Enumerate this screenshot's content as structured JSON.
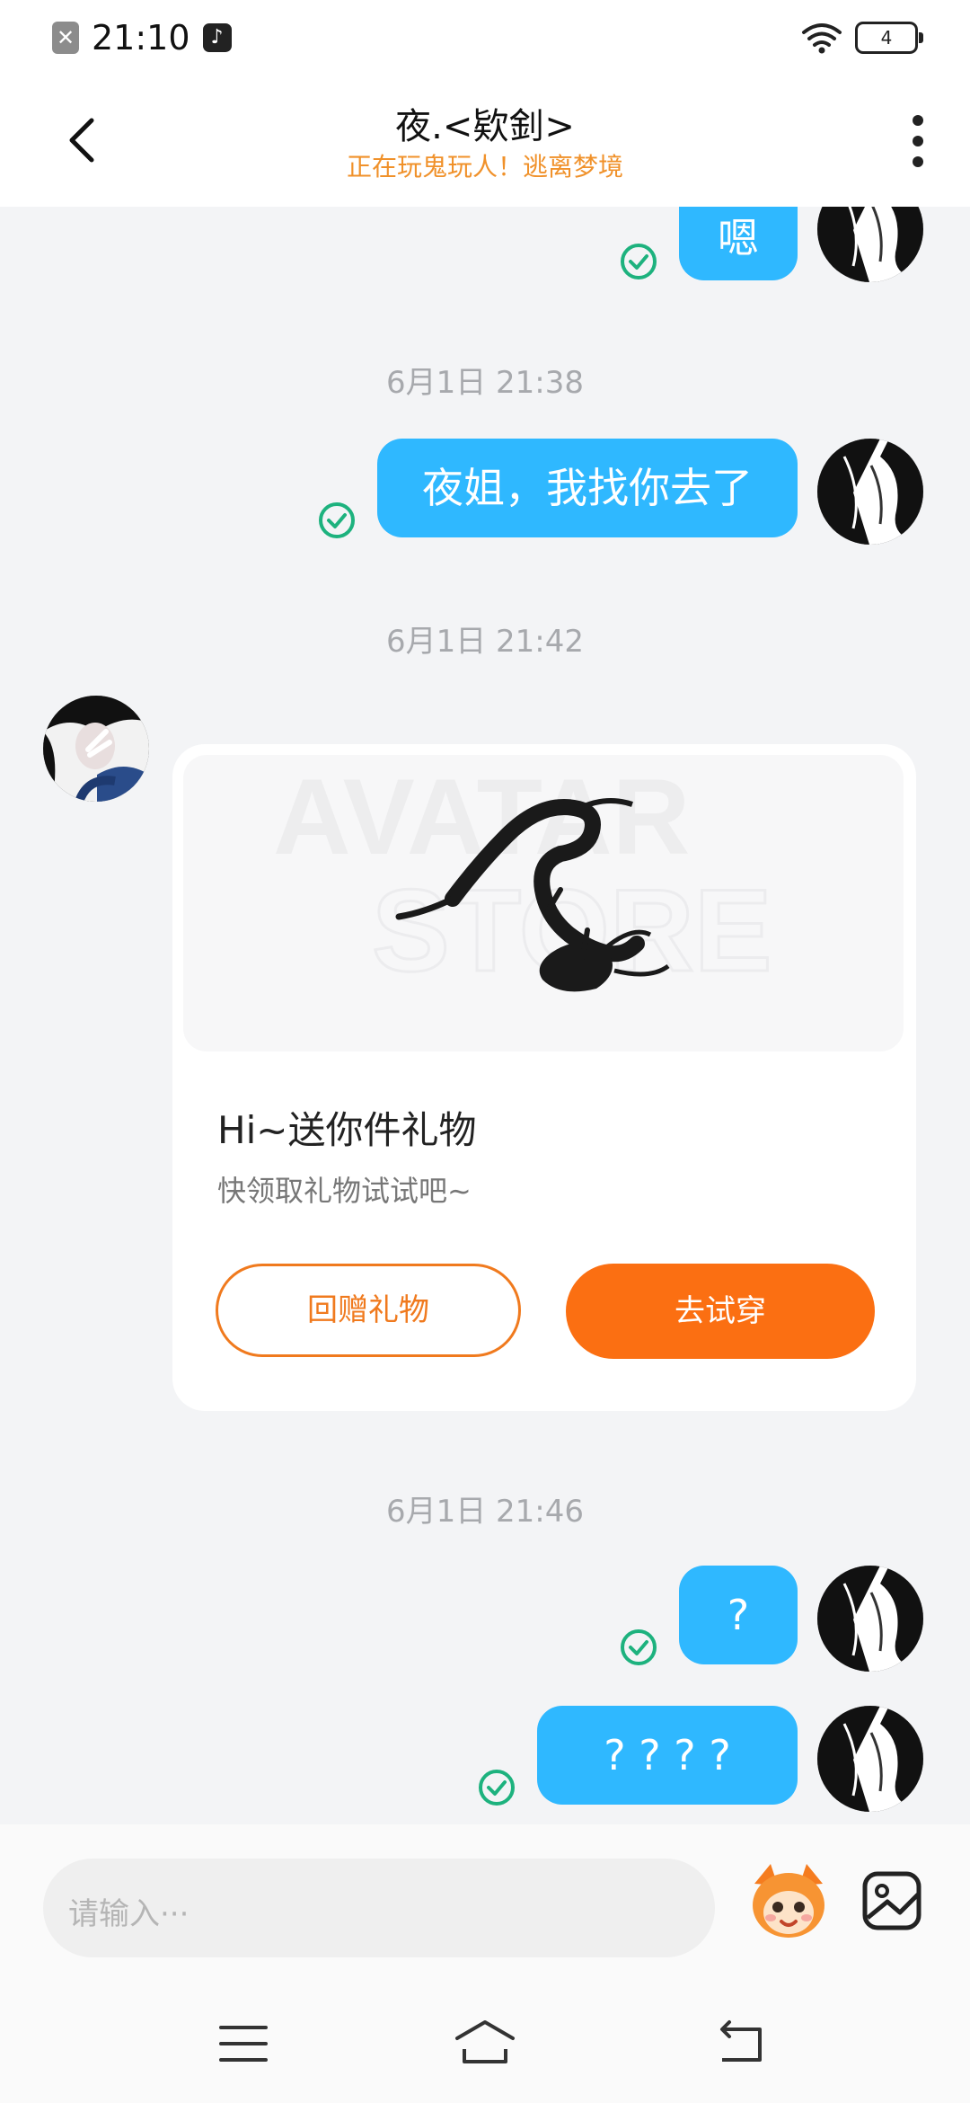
{
  "status_bar": {
    "time": "21:10",
    "battery": "4",
    "icons": [
      "notification-x-icon",
      "tiktok-icon",
      "wifi-icon",
      "battery-icon"
    ]
  },
  "header": {
    "title": "夜.<欵釗>",
    "subtitle": "正在玩鬼玩人！逃离梦境"
  },
  "messages": [
    {
      "type": "sent",
      "text": "嗯",
      "status": "read"
    },
    {
      "type": "timestamp",
      "text": "6月1日 21:38"
    },
    {
      "type": "sent",
      "text": "夜姐，我找你去了",
      "status": "read"
    },
    {
      "type": "timestamp",
      "text": "6月1日 21:42"
    },
    {
      "type": "gift_card",
      "title": "Hi~送你件礼物",
      "subtitle": "快领取礼物试试吧~",
      "watermark_top": "AVATAR",
      "watermark_bottom": "STORE",
      "gift_button": "回赠礼物",
      "try_button": "去试穿"
    },
    {
      "type": "timestamp",
      "text": "6月1日 21:46"
    },
    {
      "type": "sent",
      "text": "?",
      "status": "read"
    },
    {
      "type": "sent",
      "text": "? ? ? ?",
      "status": "read"
    }
  ],
  "input": {
    "placeholder": "请输入···"
  },
  "colors": {
    "bubble": "#2fb8ff",
    "check": "#1db27e",
    "accent_orange": "#fb6f12",
    "subtitle": "#f0912a"
  }
}
